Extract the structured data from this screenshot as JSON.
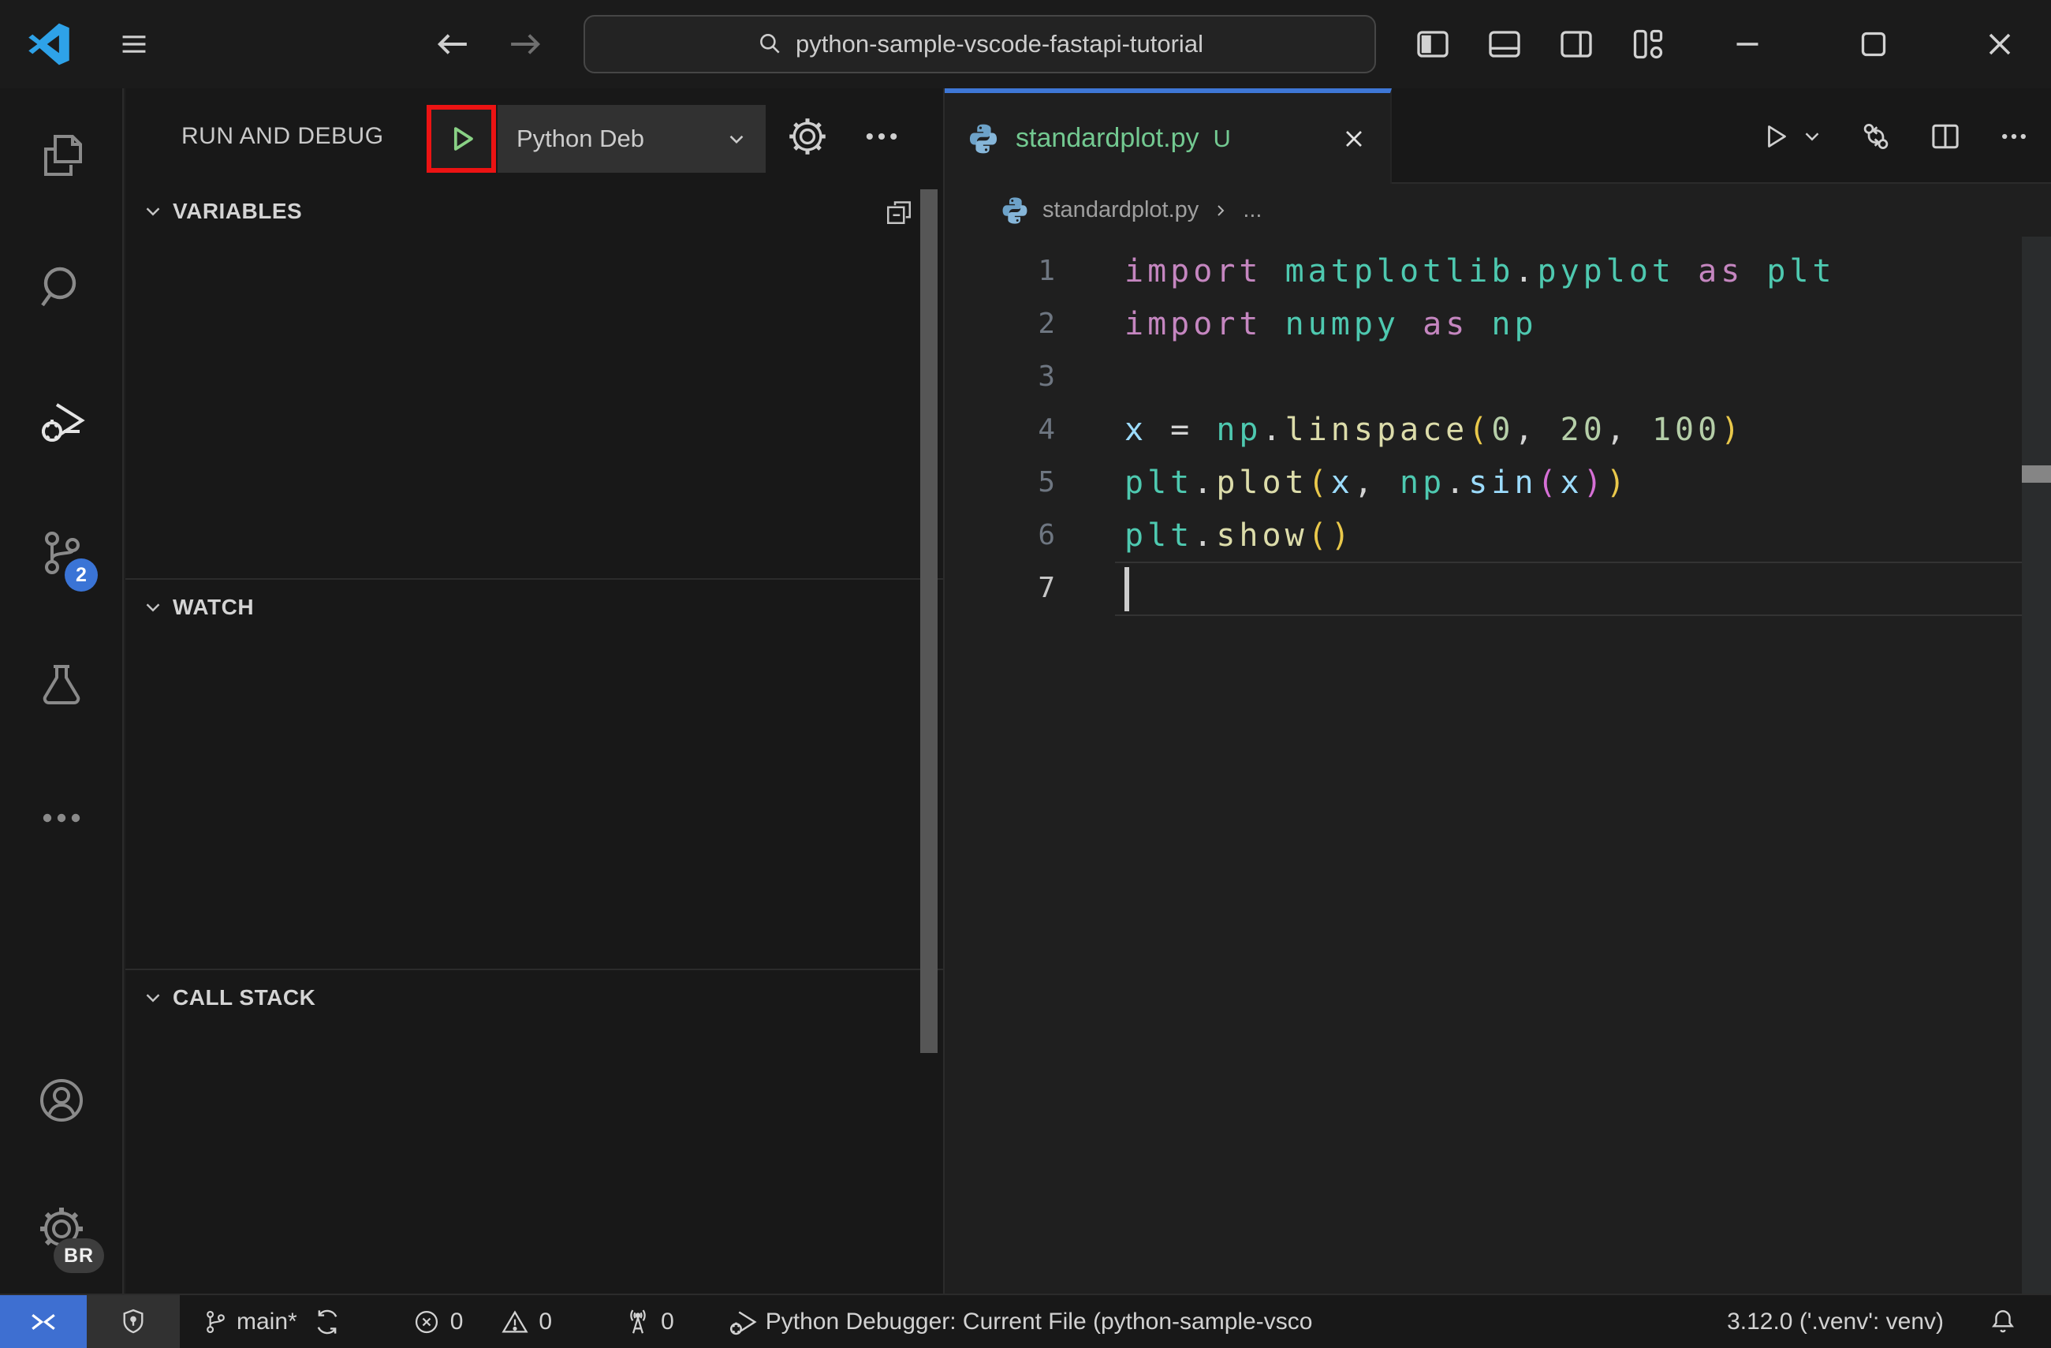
{
  "titlebar": {
    "search_value": "python-sample-vscode-fastapi-tutorial"
  },
  "activity_bar": {
    "scm_badge": "2",
    "profile_badge": "BR"
  },
  "sidebar": {
    "toolbar": {
      "title": "RUN AND DEBUG",
      "config_label": "Python Deb"
    },
    "sections": [
      {
        "label": "VARIABLES"
      },
      {
        "label": "WATCH"
      },
      {
        "label": "CALL STACK"
      }
    ]
  },
  "editor": {
    "tab": {
      "label": "standardplot.py",
      "modified_badge": "U"
    },
    "breadcrumb": {
      "file": "standardplot.py",
      "symbol": "..."
    },
    "code": {
      "lines": [
        {
          "n": "1",
          "active": false,
          "tokens": [
            [
              "kw",
              "import"
            ],
            [
              "pun",
              " "
            ],
            [
              "mod",
              "matplotlib"
            ],
            [
              "pun",
              "."
            ],
            [
              "mod",
              "pyplot"
            ],
            [
              "pun",
              " "
            ],
            [
              "kw",
              "as"
            ],
            [
              "pun",
              " "
            ],
            [
              "mod",
              "plt"
            ]
          ]
        },
        {
          "n": "2",
          "active": false,
          "tokens": [
            [
              "kw",
              "import"
            ],
            [
              "pun",
              " "
            ],
            [
              "mod",
              "numpy"
            ],
            [
              "pun",
              " "
            ],
            [
              "kw",
              "as"
            ],
            [
              "pun",
              " "
            ],
            [
              "mod",
              "np"
            ]
          ]
        },
        {
          "n": "3",
          "active": false,
          "tokens": []
        },
        {
          "n": "4",
          "active": false,
          "tokens": [
            [
              "var",
              "x"
            ],
            [
              "pun",
              " = "
            ],
            [
              "mod",
              "np"
            ],
            [
              "pun",
              "."
            ],
            [
              "fn",
              "linspace"
            ],
            [
              "b1",
              "("
            ],
            [
              "num",
              "0"
            ],
            [
              "pun",
              ", "
            ],
            [
              "num",
              "20"
            ],
            [
              "pun",
              ", "
            ],
            [
              "num",
              "100"
            ],
            [
              "b1",
              ")"
            ]
          ]
        },
        {
          "n": "5",
          "active": false,
          "tokens": [
            [
              "mod",
              "plt"
            ],
            [
              "pun",
              "."
            ],
            [
              "fn",
              "plot"
            ],
            [
              "b1",
              "("
            ],
            [
              "var",
              "x"
            ],
            [
              "pun",
              ", "
            ],
            [
              "mod",
              "np"
            ],
            [
              "pun",
              "."
            ],
            [
              "var",
              "sin"
            ],
            [
              "b2",
              "("
            ],
            [
              "var",
              "x"
            ],
            [
              "b2",
              ")"
            ],
            [
              "b1",
              ")"
            ]
          ]
        },
        {
          "n": "6",
          "active": false,
          "tokens": [
            [
              "mod",
              "plt"
            ],
            [
              "pun",
              "."
            ],
            [
              "fn",
              "show"
            ],
            [
              "b1",
              "()"
            ]
          ]
        },
        {
          "n": "7",
          "active": true,
          "tokens": []
        }
      ]
    }
  },
  "statusbar": {
    "branch": "main*",
    "errors": "0",
    "warnings": "0",
    "ports": "0",
    "debug_config": "Python Debugger: Current File (python-sample-vsco",
    "python_version": "3.12.0 ('.venv': venv)"
  },
  "colors": {
    "accent_blue": "#3e77d6",
    "untracked_green": "#73c991",
    "highlight_red": "#ec1313",
    "remote_blue": "#3e6fd1",
    "badge_blue": "#3a74d6"
  },
  "icons": [
    "vscode-logo-icon",
    "menu-icon",
    "arrow-left-icon",
    "arrow-right-icon",
    "search-icon",
    "layout-sidebar-left-icon",
    "layout-panel-icon",
    "layout-sidebar-right-icon",
    "customize-layout-icon",
    "minimize-icon",
    "maximize-icon",
    "close-icon",
    "explorer-icon",
    "debug-icon",
    "source-control-icon",
    "testing-icon",
    "ellipsis-icon",
    "account-icon",
    "gear-icon",
    "play-icon",
    "chevron-down-icon",
    "collapse-all-icon",
    "python-icon",
    "open-changes-icon",
    "split-editor-icon",
    "remote-icon",
    "shield-icon",
    "branch-icon",
    "sync-icon",
    "error-icon",
    "warning-icon",
    "radio-tower-icon",
    "bell-icon"
  ]
}
